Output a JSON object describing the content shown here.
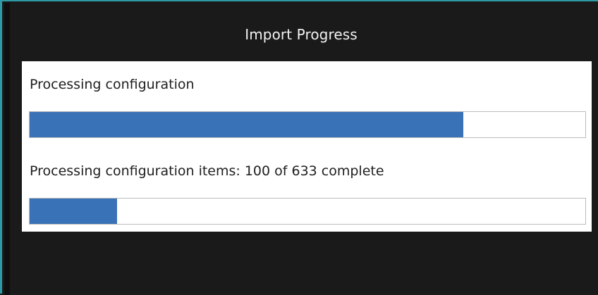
{
  "dialog": {
    "title": "Import Progress"
  },
  "progress": {
    "overall": {
      "label": "Processing configuration",
      "fraction": 0.78
    },
    "items": {
      "label": "Processing configuration items: 100 of 633 complete",
      "completed": 100,
      "total": 633
    }
  },
  "colors": {
    "accent_border": "#2d9aa6",
    "progress_fill": "#3a72b8",
    "background": "#1a1a1a",
    "panel": "#ffffff"
  }
}
